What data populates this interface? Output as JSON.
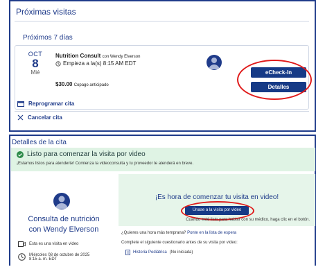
{
  "upcoming": {
    "title": "Próximas visitas",
    "range_label": "Próximos 7 días",
    "visit": {
      "month": "OCT",
      "day": "8",
      "weekday": "Mié",
      "name": "Nutrition Consult",
      "with_text": "con Wendy Elverson",
      "start_text": "Empieza a la(s) 8:15 AM EDT",
      "copay_amount": "$30.00",
      "copay_text": "Copago anticipado",
      "echeckin_label": "eCheck-In",
      "details_label": "Detalles"
    },
    "reschedule_label": "Reprogramar cita",
    "cancel_label": "Cancelar cita"
  },
  "details": {
    "title": "Detalles de la cita",
    "banner_title": "Listo para comenzar la visita por video",
    "banner_sub": "¡Estamos listos para atenderte! Comienza la videoconsulta y tu proveedor te atenderá en breve.",
    "visit_title_line1": "Consulta de nutrición",
    "visit_title_line2": "con Wendy Elverson",
    "video_visit_text": "Esta es una visita en video",
    "date_line1": "Miércoles 08 de octubre de 2025",
    "date_line2": "8:15 a. m. EDT",
    "video_heading": "¡Es hora de comenzar tu visita en video!",
    "join_label": "Únase a la visita por video",
    "ready_text": "Cuando esté listo para hablar con su médico, haga clic en el botón.",
    "earlier_text": "¿Quieres una hora más temprana?",
    "waitlist_link": "Ponte en la lista de espera",
    "questionnaire_text": "Complete el siguiente cuestionario antes de su visita por video:",
    "questionnaire_link": "Historia Pediátrica",
    "questionnaire_status": "(No iniciada)"
  },
  "colors": {
    "navy": "#1f3b8a",
    "button": "#163a86",
    "green_bg": "#dff3e4",
    "annotation_red": "#e01b1b"
  }
}
